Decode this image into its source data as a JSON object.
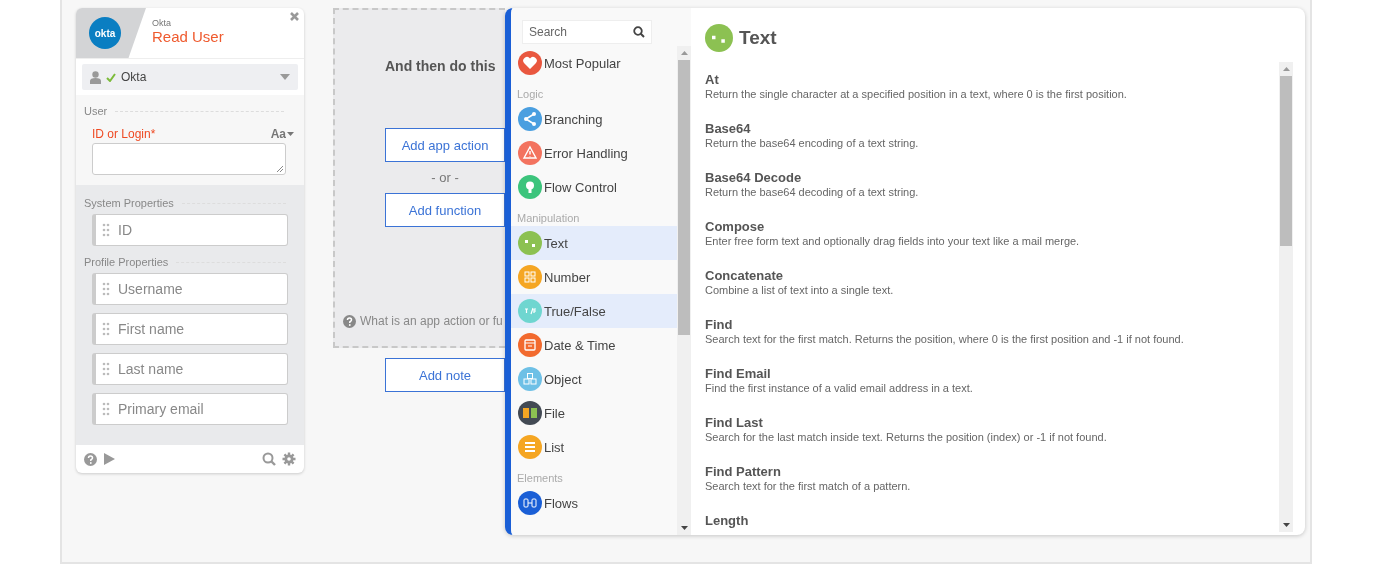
{
  "step_card": {
    "logo_text": "okta",
    "app": "Okta",
    "title": "Read User",
    "connection": {
      "label": "Okta",
      "connected": true
    },
    "input_section": {
      "label": "User",
      "field_label": "ID or Login*",
      "format_toggle": "Aa"
    },
    "groups": [
      {
        "label": "System Properties",
        "fields": [
          "ID"
        ]
      },
      {
        "label": "Profile Properties",
        "fields": [
          "Username",
          "First name",
          "Last name",
          "Primary email"
        ]
      }
    ]
  },
  "canvas": {
    "heading": "And then do this",
    "buttons": [
      "Add app action",
      "Add function"
    ],
    "separator": "- or -",
    "help": "What is an app action or fu",
    "note_button": "Add note"
  },
  "function_picker": {
    "search": {
      "placeholder": "Search"
    },
    "categories": [
      {
        "kind": "item",
        "label": "Most Popular",
        "color": "#e9573f",
        "highlighted": false
      },
      {
        "kind": "header",
        "label": "Logic"
      },
      {
        "kind": "item",
        "label": "Branching",
        "color": "#4a9fe0",
        "highlighted": false
      },
      {
        "kind": "item",
        "label": "Error Handling",
        "color": "#f3735f",
        "highlighted": false
      },
      {
        "kind": "item",
        "label": "Flow Control",
        "color": "#3cc47c",
        "highlighted": false
      },
      {
        "kind": "header",
        "label": "Manipulation"
      },
      {
        "kind": "item",
        "label": "Text",
        "color": "#8cc152",
        "highlighted": true
      },
      {
        "kind": "item",
        "label": "Number",
        "color": "#f5a623",
        "highlighted": false
      },
      {
        "kind": "item",
        "label": "True/False",
        "color": "#6fd6d0",
        "highlighted": true
      },
      {
        "kind": "item",
        "label": "Date & Time",
        "color": "#f26a2e",
        "highlighted": false
      },
      {
        "kind": "item",
        "label": "Object",
        "color": "#6ec0e6",
        "highlighted": false
      },
      {
        "kind": "item",
        "label": "File",
        "color": "#434a54",
        "highlighted": false
      },
      {
        "kind": "item",
        "label": "List",
        "color": "#f5a623",
        "highlighted": false
      },
      {
        "kind": "header",
        "label": "Elements"
      },
      {
        "kind": "item",
        "label": "Flows",
        "color": "#1a5fd6",
        "highlighted": false
      }
    ],
    "panel_title": "Text",
    "functions": [
      {
        "name": "At",
        "description": "Return the single character at a specified position in a text, where 0 is the first position."
      },
      {
        "name": "Base64",
        "description": "Return the base64 encoding of a text string."
      },
      {
        "name": "Base64 Decode",
        "description": "Return the base64 decoding of a text string."
      },
      {
        "name": "Compose",
        "description": "Enter free form text and optionally drag fields into your text like a mail merge."
      },
      {
        "name": "Concatenate",
        "description": "Combine a list of text into a single text."
      },
      {
        "name": "Find",
        "description": "Search text for the first match. Returns the position, where 0 is the first position and -1 if not found."
      },
      {
        "name": "Find Email",
        "description": "Find the first instance of a valid email address in a text."
      },
      {
        "name": "Find Last",
        "description": "Search for the last match inside text. Returns the position (index) or -1 if not found."
      },
      {
        "name": "Find Pattern",
        "description": "Search text for the first match of a pattern."
      },
      {
        "name": "Length"
      }
    ]
  }
}
